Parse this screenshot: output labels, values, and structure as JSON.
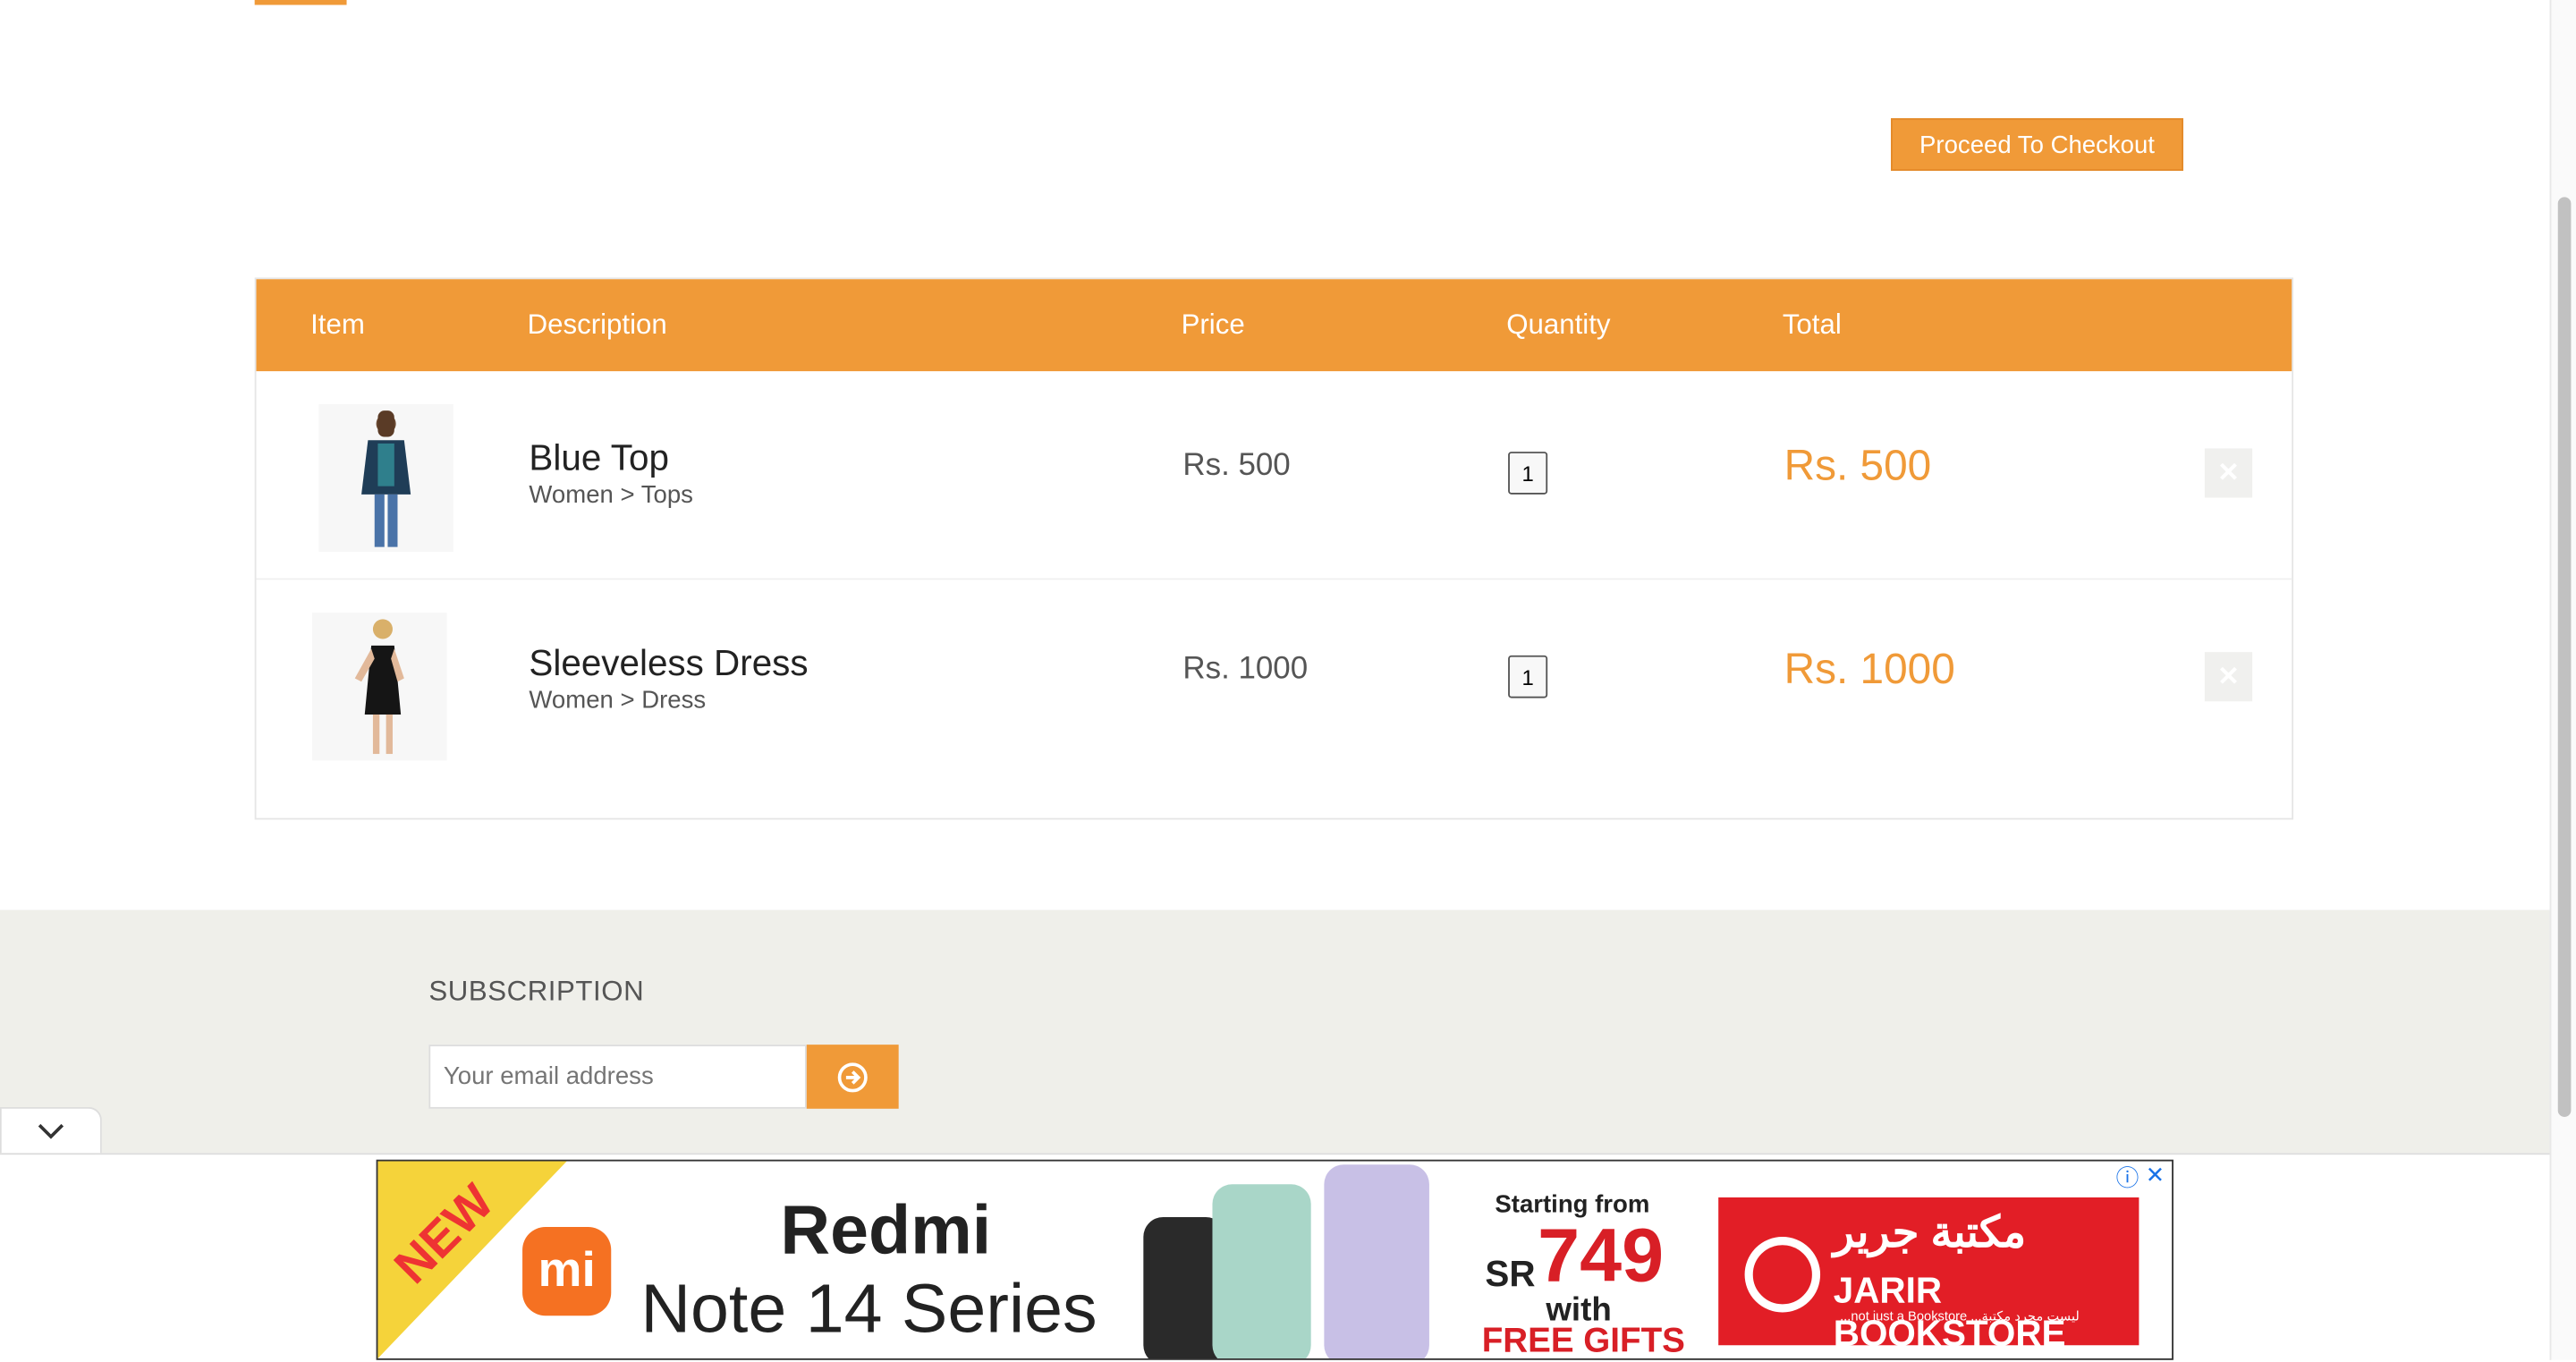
{
  "checkout": {
    "label": "Proceed To Checkout"
  },
  "cart": {
    "headers": [
      "Item",
      "Description",
      "Price",
      "Quantity",
      "Total"
    ],
    "rows": [
      {
        "name": "Blue Top",
        "category": "Women > Tops",
        "price": "Rs. 500",
        "quantity": "1",
        "total": "Rs. 500"
      },
      {
        "name": "Sleeveless Dress",
        "category": "Women > Dress",
        "price": "Rs. 1000",
        "quantity": "1",
        "total": "Rs. 1000"
      }
    ]
  },
  "footer": {
    "subscription_title": "SUBSCRIPTION",
    "email_placeholder": "Your email address"
  },
  "ad": {
    "badge": "NEW",
    "brand_logo": "mi",
    "title_line1": "Redmi",
    "title_line2": "Note 14 Series",
    "starting_from": "Starting from",
    "currency": "SR",
    "price": "749",
    "with": "with",
    "free_gifts": "FREE GIFTS",
    "store_ar": "مكتبة جرير",
    "store_en": "JARIR BOOKSTORE",
    "store_tagline": "...not just a Bookstore   ...ليست مجرد مكتبة",
    "info_icon": "ⓘ",
    "close_icon": "✕"
  },
  "colors": {
    "accent": "#f09a38",
    "footer_bg": "#efefea",
    "ad_red": "#d81f26"
  }
}
